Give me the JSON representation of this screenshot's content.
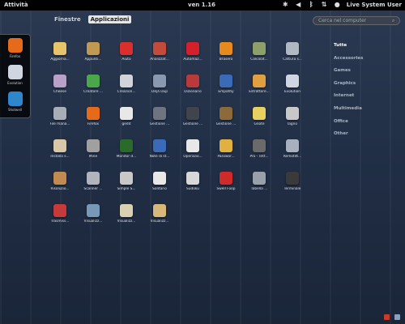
{
  "topbar": {
    "activities": "Attività",
    "clock": "ven  1.16",
    "user": "Live System User"
  },
  "dash": [
    {
      "label": "Firefox",
      "color": "#e56a1a"
    },
    {
      "label": "Evolution",
      "color": "#cfd6e2"
    },
    {
      "label": "Shotwell",
      "color": "#2e86cc"
    }
  ],
  "view_tabs": [
    "Finestre",
    "Applicazioni"
  ],
  "search": {
    "placeholder": "Cerca nel computer"
  },
  "categories": [
    "Tutte",
    "Accessories",
    "Games",
    "Graphics",
    "Internet",
    "Multimedia",
    "Office",
    "Other"
  ],
  "apps": [
    {
      "label": "Aggiorna...",
      "color": "#e7c46a"
    },
    {
      "label": "Appunti...",
      "color": "#c09a52"
    },
    {
      "label": "Aiuto",
      "color": "#d9302e"
    },
    {
      "label": "Analizzat...",
      "color": "#c44a3a"
    },
    {
      "label": "Automaz...",
      "color": "#d4202a"
    },
    {
      "label": "Brasero",
      "color": "#e68a1e"
    },
    {
      "label": "Calcolat...",
      "color": "#8da06a"
    },
    {
      "label": "Cattura s...",
      "color": "#b0b8c4"
    },
    {
      "label": "Cheese",
      "color": "#b8a0c8"
    },
    {
      "label": "Creatore ...",
      "color": "#4aa84a"
    },
    {
      "label": "Creazion...",
      "color": "#d0d4da"
    },
    {
      "label": "Déjà Dup",
      "color": "#8a98b0"
    },
    {
      "label": "Dizionario",
      "color": "#b93a3a"
    },
    {
      "label": "Empathy",
      "color": "#3a6ab8"
    },
    {
      "label": "Estrattore...",
      "color": "#e0a040"
    },
    {
      "label": "Evolution",
      "color": "#cfd6e2"
    },
    {
      "label": "File mana...",
      "color": "#a8aeb8"
    },
    {
      "label": "Firefox",
      "color": "#e56a1a"
    },
    {
      "label": "gedit",
      "color": "#e8e8e8"
    },
    {
      "label": "Gestione ...",
      "color": "#6e7480"
    },
    {
      "label": "Gestione ...",
      "color": "#40444c"
    },
    {
      "label": "Gestione ...",
      "color": "#8c6a3a"
    },
    {
      "label": "Gnote",
      "color": "#e8d060"
    },
    {
      "label": "Iagno",
      "color": "#c8c8c8"
    },
    {
      "label": "Installa s...",
      "color": "#d8c8a8"
    },
    {
      "label": "Mine",
      "color": "#a0a0a0"
    },
    {
      "label": "Monitor d...",
      "color": "#2a6a2a"
    },
    {
      "label": "Note di st...",
      "color": "#3a6ab8"
    },
    {
      "label": "Operazio...",
      "color": "#e8e8e8"
    },
    {
      "label": "Passwor...",
      "color": "#e0b040"
    },
    {
      "label": "Pro - Tett...",
      "color": "#6a6a6a"
    },
    {
      "label": "Remotdt...",
      "color": "#a8b0c0"
    },
    {
      "label": "Risoluzio...",
      "color": "#c08a50"
    },
    {
      "label": "Scanner ...",
      "color": "#b0b4bc"
    },
    {
      "label": "Simple S...",
      "color": "#c8c8c8"
    },
    {
      "label": "Solitario",
      "color": "#e8e8e8"
    },
    {
      "label": "Sudoku",
      "color": "#d8d8d8"
    },
    {
      "label": "Swell Foop",
      "color": "#d02a2a"
    },
    {
      "label": "Tabella ...",
      "color": "#9aa0aa"
    },
    {
      "label": "Terminale",
      "color": "#3a3a3a"
    },
    {
      "label": "Trasmiss...",
      "color": "#c83a3a"
    },
    {
      "label": "Visualizz...",
      "color": "#7898b8"
    },
    {
      "label": "Visualizz...",
      "color": "#d8d0b0"
    },
    {
      "label": "Visualizz...",
      "color": "#d8b878"
    }
  ]
}
